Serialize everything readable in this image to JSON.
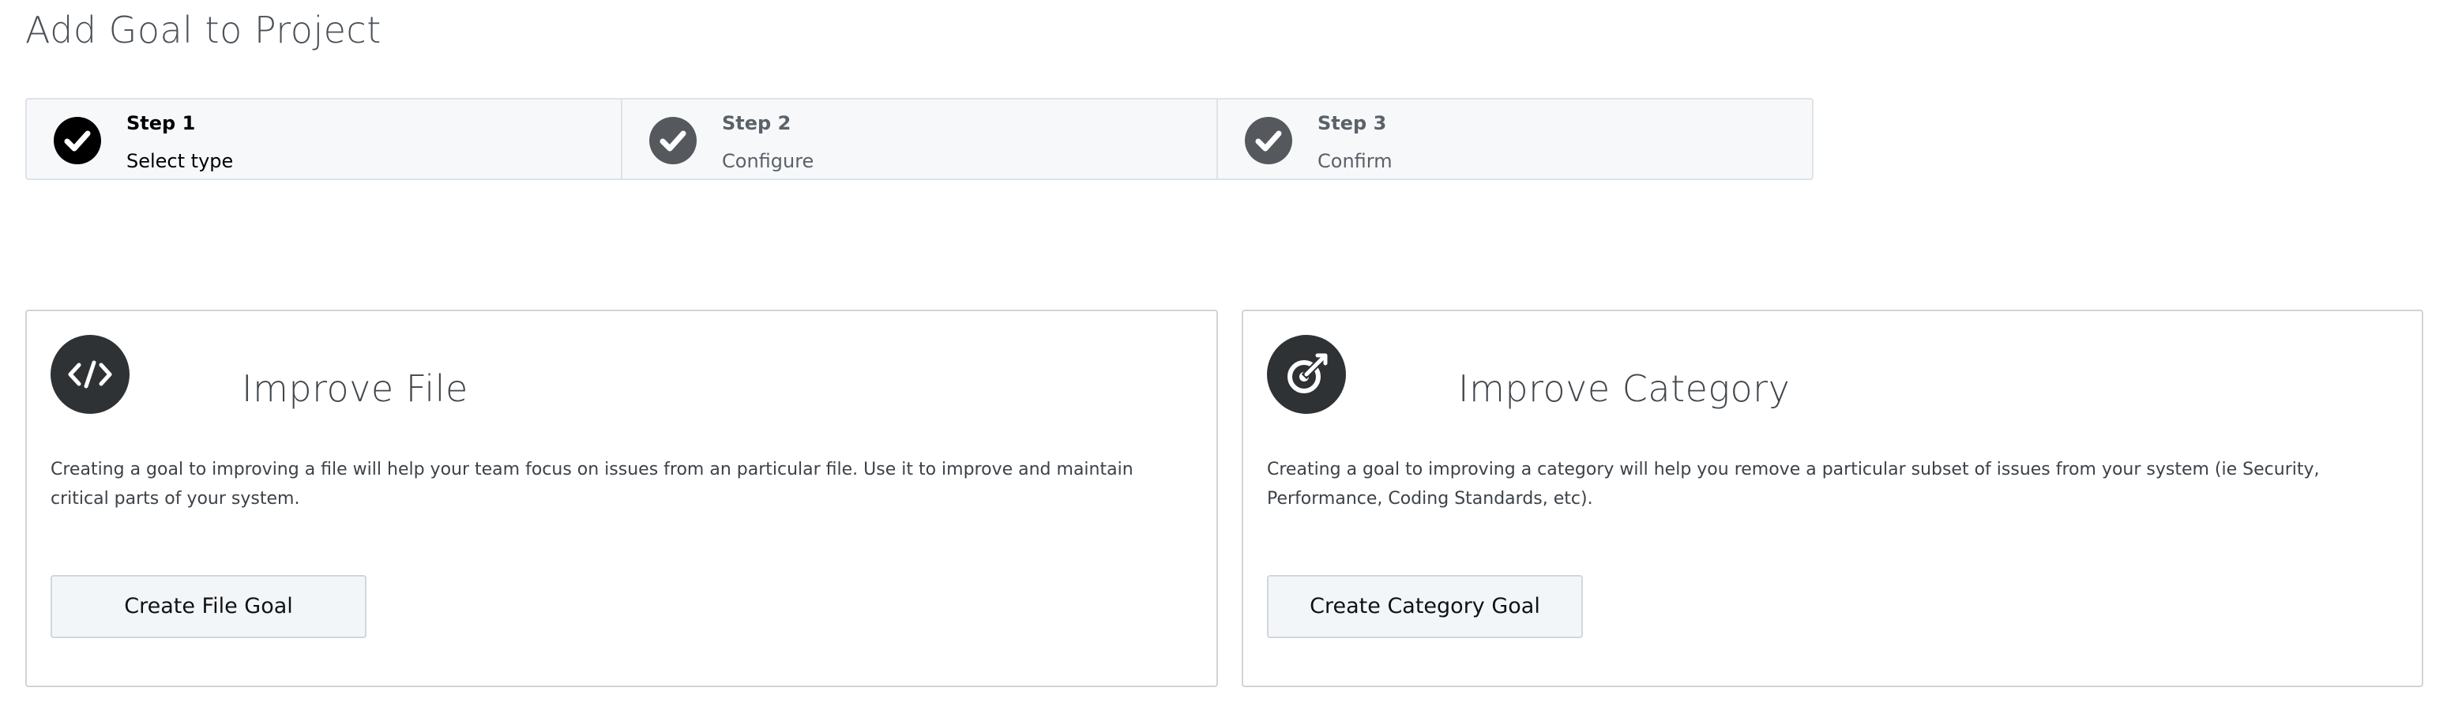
{
  "page": {
    "title": "Add Goal to Project"
  },
  "stepper": {
    "steps": [
      {
        "label": "Step 1",
        "sublabel": "Select type",
        "state": "active",
        "icon": "check-circle-icon",
        "icon_color": "#000000"
      },
      {
        "label": "Step 2",
        "sublabel": "Configure",
        "state": "inactive",
        "icon": "check-circle-icon",
        "icon_color": "#55595e"
      },
      {
        "label": "Step 3",
        "sublabel": "Confirm",
        "state": "inactive",
        "icon": "check-circle-icon",
        "icon_color": "#55595e"
      }
    ]
  },
  "cards": {
    "file": {
      "icon": "code-icon",
      "title": "Improve File",
      "description": "Creating a goal to improving a file will help your team focus on issues from an particular file. Use it to improve and maintain critical parts of your system.",
      "button_label": "Create File Goal"
    },
    "category": {
      "icon": "target-icon",
      "title": "Improve Category",
      "description": "Creating a goal to improving a category will help you remove a particular subset of issues from your system (ie Security, Performance, Coding Standards, etc).",
      "button_label": "Create Category Goal"
    }
  },
  "colors": {
    "stepper_background": "#f6f8fa",
    "border": "#dfe3e8",
    "icon_dark": "#2f3234",
    "button_background": "#f3f6f9"
  }
}
